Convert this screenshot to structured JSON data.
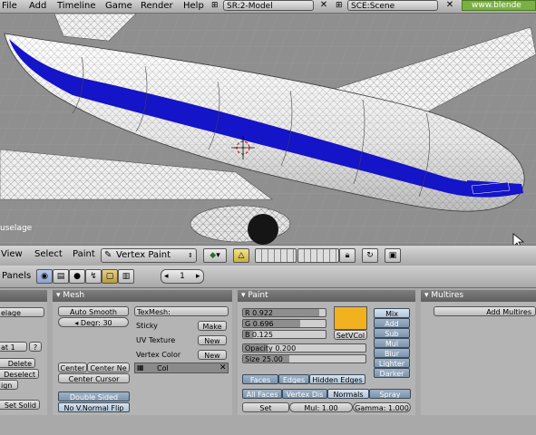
{
  "topbar": {
    "menus": [
      "File",
      "Add",
      "Timeline",
      "Game",
      "Render",
      "Help"
    ],
    "screen_select": "SR:2-Model",
    "scene_select": "SCE:Scene",
    "website": "www.blende"
  },
  "viewport": {
    "object_label": "uselage"
  },
  "header3d": {
    "menus": [
      "View",
      "Select",
      "Paint"
    ],
    "mode_select": "Vertex Paint"
  },
  "panels_header": {
    "label": "Panels",
    "page_number": "1"
  },
  "left_panel": {
    "field_name": "elage",
    "mat_field": "at 1",
    "mat_question": "?",
    "delete_label": "Delete",
    "deselect_label": "Deselect",
    "assign_label": "ign",
    "set_solid_label": "Set Solid"
  },
  "mesh_panel": {
    "title": "Mesh",
    "auto_smooth": "Auto Smooth",
    "degr": "Degr: 30",
    "texmesh": "TexMesh:",
    "sticky": "Sticky",
    "make": "Make",
    "uv_texture": "UV Texture",
    "new1": "New",
    "vertex_color": "Vertex Color",
    "new2": "New",
    "col": "Col",
    "center": "Center",
    "center_new": "Center Ne",
    "center_cursor": "Center Cursor",
    "double_sided": "Double Sided",
    "no_v_normal_flip": "No V.Normal Flip"
  },
  "paint_panel": {
    "title": "Paint",
    "r": "R 0.922",
    "g": "G 0.696",
    "b": "B 0.125",
    "opacity": "Opacity 0.200",
    "size": "Size 25.00",
    "setvcol": "SetVCol",
    "color_swatch": "#f2b21f",
    "r_val": 0.922,
    "g_val": 0.696,
    "b_val": 0.125,
    "opacity_val": 0.2,
    "size_val": 0.38,
    "modes": [
      "Mix",
      "Add",
      "Sub",
      "Mul",
      "Blur",
      "Lighter",
      "Darker"
    ],
    "faces": "Faces",
    "edges": "Edges",
    "hidden_edges": "Hidden Edges",
    "all_faces": "All Faces",
    "vertex_dist": "Vertex Dis",
    "normals": "Normals",
    "spray": "Spray",
    "set": "Set",
    "mul": "Mul: 1.00",
    "gamma": "Gamma: 1.000"
  },
  "multires_panel": {
    "title": "Multires",
    "add_multires": "Add Multires"
  }
}
